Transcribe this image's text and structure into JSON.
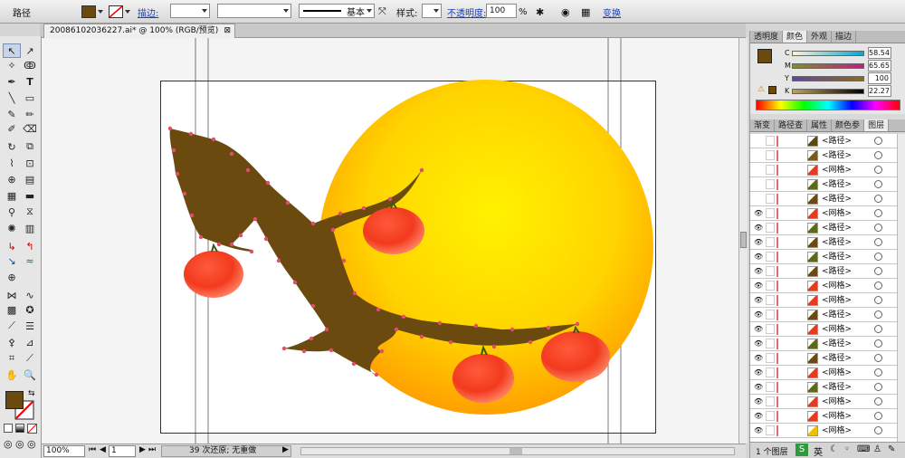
{
  "control": {
    "object_type": "路径",
    "stroke_label": "描边:",
    "brush_label": "基本",
    "style_label": "样式:",
    "opacity_label": "不透明度:",
    "opacity_value": "100",
    "percent": "%",
    "transform_label": "变换"
  },
  "document": {
    "tab_title": "20086102036227.ai* @ 100% (RGB/预览)"
  },
  "status": {
    "zoom": "100%",
    "page": "1",
    "undo_text": "39 次还原; 无重做"
  },
  "panels": {
    "top_tabs": [
      "透明度",
      "颜色",
      "外观",
      "描边"
    ],
    "top_active": 1,
    "color": {
      "C": "58.54",
      "M": "65.65",
      "Y": "100",
      "K": "22.27",
      "fill_color": "#6b4a10"
    },
    "second_tabs": [
      "渐变",
      "路径查",
      "属性",
      "颜色参",
      "图层"
    ],
    "second_active": 4,
    "layers": [
      {
        "name": "<路径>",
        "thumb": "#5a4a10"
      },
      {
        "name": "<路径>",
        "thumb": "#7a5a18"
      },
      {
        "name": "<网格>",
        "thumb": "#e53a1e"
      },
      {
        "name": "<路径>",
        "thumb": "#5a6a18"
      },
      {
        "name": "<路径>",
        "thumb": "#6b4a10"
      },
      {
        "name": "<网格>",
        "thumb": "#e53a1e"
      },
      {
        "name": "<路径>",
        "thumb": "#5a6a18"
      },
      {
        "name": "<路径>",
        "thumb": "#6b4a10"
      },
      {
        "name": "<路径>",
        "thumb": "#5a6a18"
      },
      {
        "name": "<路径>",
        "thumb": "#6b4a10"
      },
      {
        "name": "<网格>",
        "thumb": "#e53a1e"
      },
      {
        "name": "<网格>",
        "thumb": "#e53a1e"
      },
      {
        "name": "<路径>",
        "thumb": "#6b4a10"
      },
      {
        "name": "<网格>",
        "thumb": "#e53a1e"
      },
      {
        "name": "<路径>",
        "thumb": "#5a6a18"
      },
      {
        "name": "<路径>",
        "thumb": "#6b4a10"
      },
      {
        "name": "<网格>",
        "thumb": "#e53a1e"
      },
      {
        "name": "<路径>",
        "thumb": "#5a6a18"
      },
      {
        "name": "<网格>",
        "thumb": "#e53a1e"
      },
      {
        "name": "<网格>",
        "thumb": "#e53a1e"
      },
      {
        "name": "<网格>",
        "thumb": "#f0c000"
      }
    ],
    "layer_count": "1 个图层"
  },
  "ime": {
    "lang": "英"
  },
  "icons": {
    "selection": "↖",
    "direct": "↗",
    "type": "T",
    "zoom": "🔍",
    "hand": "✋"
  }
}
